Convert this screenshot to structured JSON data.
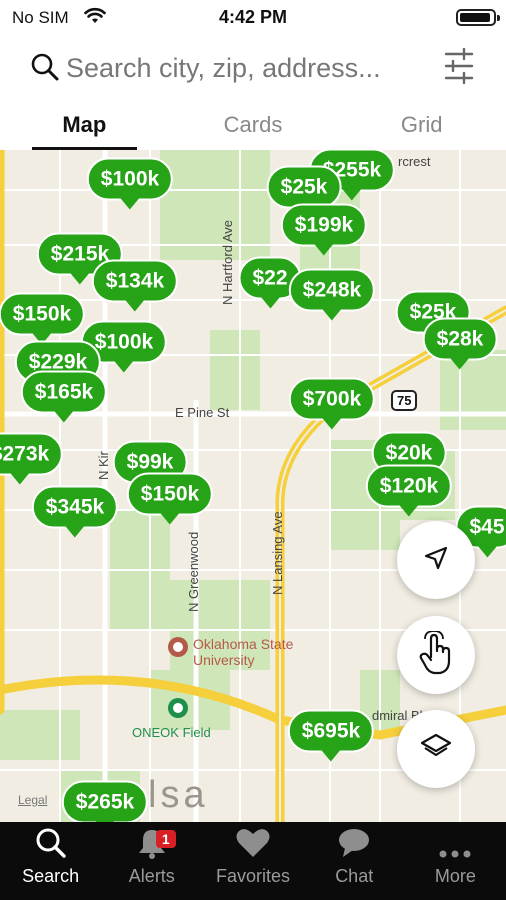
{
  "status": {
    "carrier": "No SIM",
    "time": "4:42 PM"
  },
  "search": {
    "placeholder": "Search city, zip, address..."
  },
  "tabs": [
    {
      "label": "Map",
      "active": true
    },
    {
      "label": "Cards",
      "active": false
    },
    {
      "label": "Grid",
      "active": false
    }
  ],
  "map": {
    "pins": [
      "$100k",
      "$255k",
      "$25k",
      "$199k",
      "$215k",
      "$134k",
      "$22",
      "$248k",
      "$25k",
      "$28k",
      "$150k",
      "$100k",
      "$229k",
      "$165k",
      "$700k",
      "$273k",
      "$99k",
      "$150k",
      "$20k",
      "$120k",
      "$345k",
      "$45",
      "$695k",
      "$265k"
    ],
    "labels": {
      "pine_st": "E Pine St",
      "hartford": "N Hartford Ave",
      "greenwood": "N Greenwood",
      "lansing": "N Lansing Ave",
      "kir": "N Kir",
      "admiral": "dmiral Bl",
      "highway": "75",
      "university": "Oklahoma State University",
      "park": "ONEOK Field",
      "city": "lsa",
      "legal": "Legal",
      "top_fragment": "rcrest"
    }
  },
  "nav": [
    {
      "label": "Search",
      "active": true
    },
    {
      "label": "Alerts",
      "badge": "1"
    },
    {
      "label": "Favorites"
    },
    {
      "label": "Chat"
    },
    {
      "label": "More"
    }
  ],
  "colors": {
    "pin": "#27a318",
    "badge": "#d81f26",
    "nav_bg": "#0b0b0b"
  }
}
